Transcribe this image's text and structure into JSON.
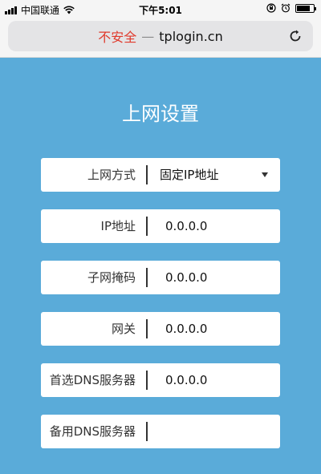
{
  "status_bar": {
    "carrier": "中国联通",
    "time": "下午5:01"
  },
  "url_bar": {
    "security_label": "不安全",
    "separator": "—",
    "host": "tplogin.cn"
  },
  "page": {
    "title": "上网设置",
    "fields": [
      {
        "label": "上网方式",
        "value": "固定IP地址"
      },
      {
        "label": "IP地址",
        "value": "0.0.0.0"
      },
      {
        "label": "子网掩码",
        "value": "0.0.0.0"
      },
      {
        "label": "网关",
        "value": "0.0.0.0"
      },
      {
        "label": "首选DNS服务器",
        "value": "0.0.0.0"
      },
      {
        "label": "备用DNS服务器",
        "value": ""
      }
    ]
  },
  "colors": {
    "background": "#5aabd9",
    "insecure": "#e0392b"
  },
  "icons": [
    "signal-icon",
    "wifi-icon",
    "lock-rotation-icon",
    "alarm-icon",
    "battery-icon",
    "reload-icon",
    "dropdown-caret-icon"
  ]
}
